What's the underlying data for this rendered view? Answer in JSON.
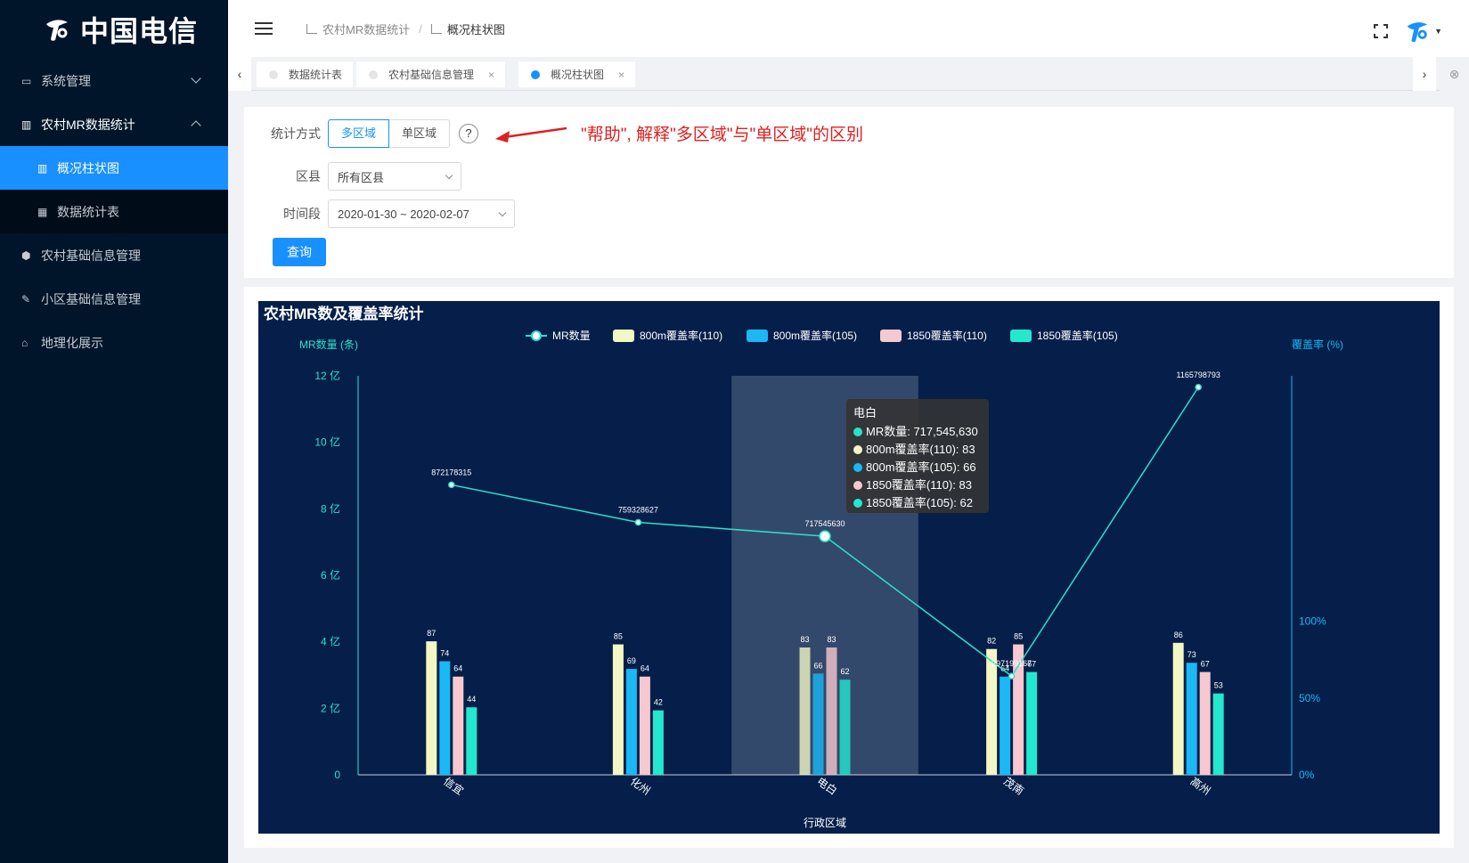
{
  "brand": {
    "name": "中国电信"
  },
  "sidebar": {
    "items": [
      {
        "label": "系统管理",
        "icon": "monitor-icon",
        "expand": "down"
      },
      {
        "label": "农村MR数据统计",
        "icon": "bar-chart-icon",
        "expand": "up",
        "open": true
      },
      {
        "label": "概况柱状图",
        "icon": "bar-chart-icon",
        "sub": true,
        "active": true
      },
      {
        "label": "数据统计表",
        "icon": "table-icon",
        "sub": true
      },
      {
        "label": "农村基础信息管理",
        "icon": "hexagon-icon"
      },
      {
        "label": "小区基础信息管理",
        "icon": "telecom-icon"
      },
      {
        "label": "地理化展示",
        "icon": "map-icon"
      }
    ]
  },
  "header": {
    "breadcrumb": [
      "农村MR数据统计",
      "概况柱状图"
    ]
  },
  "tabs": [
    {
      "label": "数据统计表",
      "closable": false,
      "active": false
    },
    {
      "label": "农村基础信息管理",
      "closable": true,
      "active": false
    },
    {
      "label": "概况柱状图",
      "closable": true,
      "active": true
    }
  ],
  "form": {
    "mode_label": "统计方式",
    "mode_options": [
      "多区域",
      "单区域"
    ],
    "mode_selected": "多区域",
    "help": "?",
    "annotation": "\"帮助\", 解释\"多区域\"与\"单区域\"的区别",
    "district_label": "区县",
    "district_value": "所有区县",
    "period_label": "时间段",
    "period_value": "2020-01-30 ~ 2020-02-07",
    "query_button": "查询"
  },
  "colors": {
    "sidebar_bg": "#001529",
    "accent": "#1890ff",
    "chart_bg": "#051f4a",
    "annotation": "#e02020"
  },
  "chart_data": {
    "type": "bar",
    "title": "农村MR数及覆盖率统计",
    "xlabel": "行政区域",
    "ylabel_left": "MR数量 (条)",
    "ylabel_right": "覆盖率 (%)",
    "categories": [
      "信宜",
      "化州",
      "电白",
      "茂南",
      "高州"
    ],
    "left_ticks": [
      "0",
      "2 亿",
      "4 亿",
      "6 亿",
      "8 亿",
      "10 亿",
      "12 亿"
    ],
    "right_ticks": [
      "0%",
      "50%",
      "100%"
    ],
    "ylim_left": [
      0,
      1200000000
    ],
    "ylim_right": [
      0,
      260
    ],
    "line_series": {
      "name": "MR数量",
      "values": [
        872178315,
        759328627,
        717545630,
        297000000,
        1165798793
      ],
      "labels": [
        "872178315",
        "759328627",
        "717545630",
        "297199167",
        "1165798793"
      ],
      "color": "#2de0c8"
    },
    "series": [
      {
        "name": "800m覆盖率(110)",
        "values": [
          87,
          85,
          83,
          82,
          86
        ],
        "color": "#f2f7c4"
      },
      {
        "name": "800m覆盖率(105)",
        "values": [
          74,
          69,
          66,
          64,
          73
        ],
        "color": "#1ab8f5"
      },
      {
        "name": "1850覆盖率(110)",
        "values": [
          64,
          64,
          83,
          85,
          67
        ],
        "color": "#f7c8cf"
      },
      {
        "name": "1850覆盖率(105)",
        "values": [
          44,
          42,
          62,
          67,
          53
        ],
        "color": "#22e8d0"
      }
    ],
    "highlight_category": "电白",
    "tooltip": {
      "title": "电白",
      "lines": [
        "MR数量: 717,545,630",
        "800m覆盖率(110): 83",
        "800m覆盖率(105): 66",
        "1850覆盖率(110): 83",
        "1850覆盖率(105): 62"
      ]
    }
  }
}
